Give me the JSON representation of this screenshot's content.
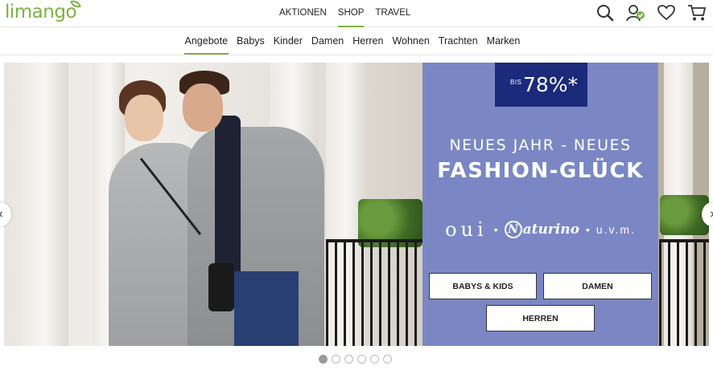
{
  "header": {
    "logo_text": "limango",
    "nav": [
      {
        "label": "AKTIONEN",
        "active": false
      },
      {
        "label": "SHOP",
        "active": true
      },
      {
        "label": "TRAVEL",
        "active": false
      }
    ],
    "icons": [
      "search-icon",
      "account-icon",
      "wishlist-icon",
      "cart-icon"
    ]
  },
  "subnav": {
    "items": [
      {
        "label": "Angebote",
        "active": true
      },
      {
        "label": "Babys",
        "active": false
      },
      {
        "label": "Kinder",
        "active": false
      },
      {
        "label": "Damen",
        "active": false
      },
      {
        "label": "Herren",
        "active": false
      },
      {
        "label": "Wohnen",
        "active": false
      },
      {
        "label": "Trachten",
        "active": false
      },
      {
        "label": "Marken",
        "active": false
      }
    ]
  },
  "hero": {
    "badge_prefix": "BIS",
    "badge_value": "78%*",
    "headline_line1": "NEUES JAHR - NEUES",
    "headline_line2": "FASHION-GLÜCK",
    "brand_oui": "oui",
    "brand_naturino": "aturino",
    "brand_naturino_initial": "N",
    "brand_more": "u.v.m.",
    "buttons": [
      "BABYS & KIDS",
      "DAMEN",
      "HERREN"
    ]
  },
  "carousel": {
    "prev": "‹",
    "next": "›",
    "slide_count": 6,
    "active_index": 0
  },
  "colors": {
    "brand_green": "#7cb342",
    "panel_blue": "#7a87c4",
    "badge_navy": "#1b2a7a"
  }
}
